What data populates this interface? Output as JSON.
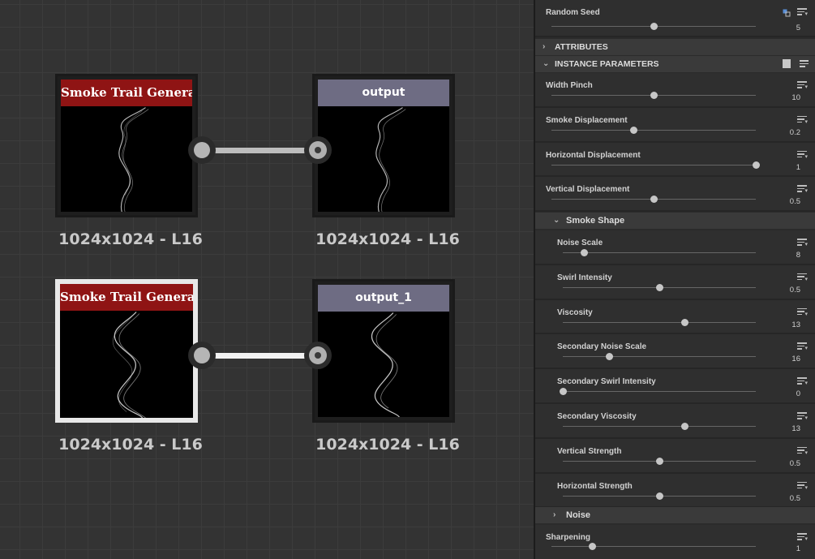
{
  "graph": {
    "nodes": [
      {
        "title": "Smoke Trail Generator",
        "label": "1024x1024 - L16"
      },
      {
        "title": "output",
        "label": "1024x1024 - L16"
      },
      {
        "title": "Smoke Trail Generator",
        "label": "1024x1024 - L16"
      },
      {
        "title": "output_1",
        "label": "1024x1024 - L16"
      }
    ]
  },
  "panel": {
    "random_seed": {
      "label": "Random Seed",
      "value": "5"
    },
    "sections": {
      "attributes": "ATTRIBUTES",
      "instance_parameters": "INSTANCE PARAMETERS",
      "smoke_shape": "Smoke Shape",
      "noise": "Noise"
    },
    "params": [
      {
        "label": "Width Pinch",
        "value": "10",
        "fraction": 0.5
      },
      {
        "label": "Smoke Displacement",
        "value": "0.2",
        "fraction": 0.4
      },
      {
        "label": "Horizontal Displacement",
        "value": "1",
        "fraction": 1.0
      },
      {
        "label": "Vertical Displacement",
        "value": "0.5",
        "fraction": 0.5
      }
    ],
    "smoke_shape_params": [
      {
        "label": "Noise Scale",
        "value": "8",
        "fraction": 0.11
      },
      {
        "label": "Swirl Intensity",
        "value": "0.5",
        "fraction": 0.5
      },
      {
        "label": "Viscosity",
        "value": "13",
        "fraction": 0.63
      },
      {
        "label": "Secondary Noise Scale",
        "value": "16",
        "fraction": 0.24
      },
      {
        "label": "Secondary Swirl Intensity",
        "value": "0",
        "fraction": 0.0
      },
      {
        "label": "Secondary Viscosity",
        "value": "13",
        "fraction": 0.63
      },
      {
        "label": "Vertical Strength",
        "value": "0.5",
        "fraction": 0.5
      },
      {
        "label": "Horizontal Strength",
        "value": "0.5",
        "fraction": 0.5
      }
    ],
    "sharpening": {
      "label": "Sharpening",
      "value": "1",
      "fraction": 0.2
    },
    "random_seed_fraction": 0.5
  }
}
